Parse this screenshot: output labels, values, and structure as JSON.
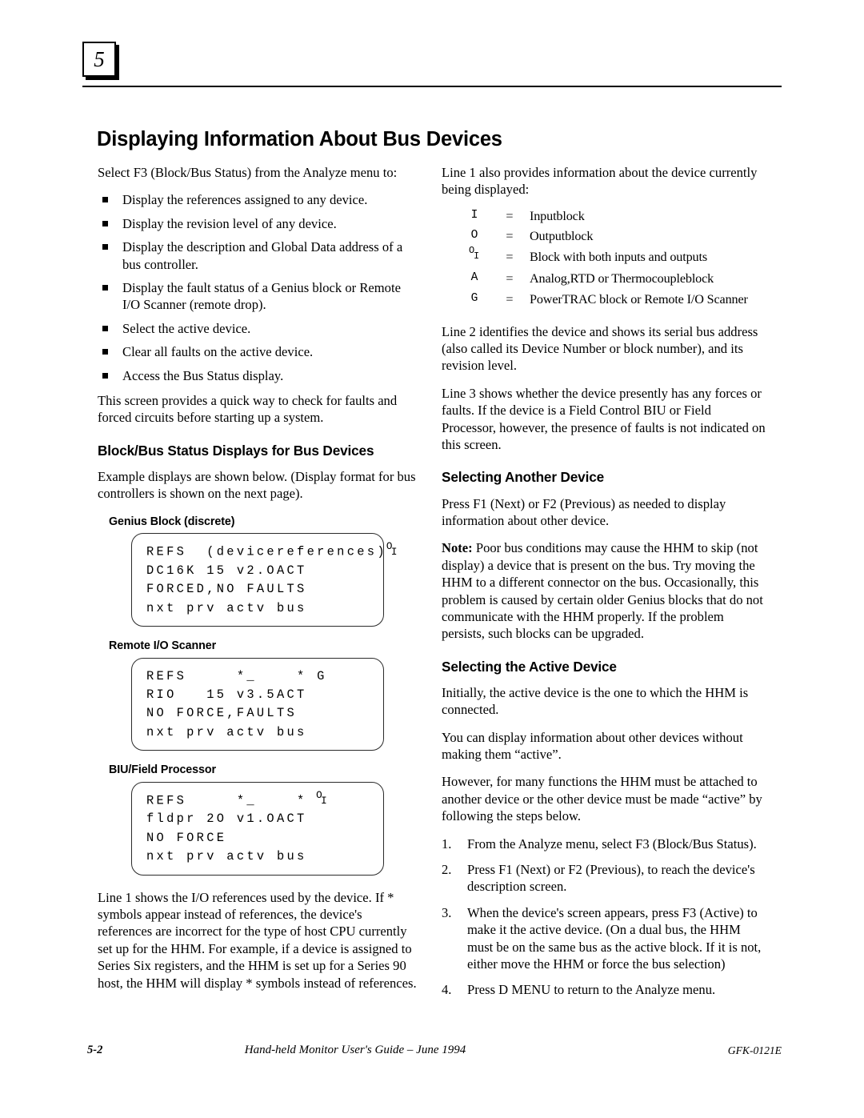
{
  "chapter": {
    "number": "5"
  },
  "page_title": "Displaying Information About Bus Devices",
  "left_column": {
    "intro": "Select F3 (Block/Bus Status) from the Analyze menu to:",
    "bullets": [
      "Display the references assigned to any device.",
      "Display the revision level of any device.",
      "Display the description and Global Data address of a bus controller.",
      "Display the fault status of a Genius block or Remote I/O Scanner (remote drop).",
      "Select the active device.",
      "Clear all faults on the active device.",
      "Access the Bus Status display."
    ],
    "quick_way": "This screen provides a quick way to check for faults and forced circuits before starting up a system.",
    "section_heading": "Block/Bus Status Displays for Bus Devices",
    "example_intro": "Example displays are shown below. (Display format for  bus controllers is shown on the next page).",
    "displays": [
      {
        "label": "Genius Block (discrete)",
        "lines": [
          {
            "pre": "REFS  (devicereferences)",
            "suffix": "oi"
          },
          {
            "pre": "DC16K 15 v2.OACT",
            "suffix": ""
          },
          {
            "pre": "FORCED,NO FAULTS",
            "suffix": ""
          },
          {
            "pre": "nxt prv actv bus",
            "suffix": ""
          }
        ]
      },
      {
        "label": "Remote I/O Scanner",
        "lines": [
          {
            "pre": "REFS     *_    * G",
            "suffix": ""
          },
          {
            "pre": "RIO   15 v3.5ACT",
            "suffix": ""
          },
          {
            "pre": "NO FORCE,FAULTS",
            "suffix": ""
          },
          {
            "pre": "nxt prv actv bus",
            "suffix": ""
          }
        ]
      },
      {
        "label": "BIU/Field Processor",
        "lines": [
          {
            "pre": "REFS     *_    * ",
            "suffix": "oi"
          },
          {
            "pre": "fldpr 2O v1.OACT",
            "suffix": ""
          },
          {
            "pre": "NO FORCE",
            "suffix": ""
          },
          {
            "pre": "nxt prv actv bus",
            "suffix": ""
          }
        ]
      }
    ],
    "line1_para": "Line 1 shows the I/O references used by the device. If * symbols appear instead of references, the device's references are incorrect for the type of host CPU currently set up for the HHM.  For example, if a device is assigned to Series Six registers, and the HHM is set up for a Series 90 host, the HHM will display * symbols instead of references."
  },
  "right_column": {
    "line1_intro": "Line 1 also provides information about the device currently being displayed:",
    "legend": [
      {
        "symbol": "I",
        "symbol_type": "plain",
        "eq": "=",
        "description": "Inputblock"
      },
      {
        "symbol": "O",
        "symbol_type": "plain",
        "eq": "=",
        "description": "Outputblock"
      },
      {
        "symbol": "OI",
        "symbol_type": "oi",
        "eq": "=",
        "description": "Block with both inputs and outputs"
      },
      {
        "symbol": "A",
        "symbol_type": "plain",
        "eq": "=",
        "description": "Analog,RTD or Thermocoupleblock"
      },
      {
        "symbol": "G",
        "symbol_type": "plain",
        "eq": "=",
        "description": "PowerTRAC block or Remote I/O Scanner"
      }
    ],
    "line2_para": "Line 2 identifies the device and shows its serial bus address (also called its Device Number or block number), and its revision level.",
    "line3_para": "Line 3 shows whether the device presently has any forces or faults. If the device is a Field Control BIU or Field Processor, however, the presence of faults is not indicated on this screen.",
    "selecting_another_heading": "Selecting Another Device",
    "selecting_another_para": "Press F1 (Next) or F2 (Previous) as needed to display information about other device.",
    "note_label": "Note:",
    "note_body": " Poor bus conditions may cause the HHM to skip (not display) a device that is present on the bus.  Try moving the HHM to a different connector on the bus. Occasionally, this problem is caused by certain older Genius blocks that do not communicate with the HHM properly. If the problem persists, such blocks can be upgraded.",
    "active_heading": "Selecting the Active Device",
    "active_para1": "Initially, the active device is the one to which the HHM is connected.",
    "active_para2": "You can display information about other devices without making them “active”.",
    "active_para3": "However, for many functions the HHM must be attached to another device or the other device must be made “active” by following the steps below.",
    "steps": [
      {
        "num": "1.",
        "text": "From the Analyze menu, select F3 (Block/Bus Status)."
      },
      {
        "num": "2.",
        "text": "Press F1 (Next) or F2 (Previous), to reach the device's description screen."
      },
      {
        "num": "3.",
        "text": "When the device's screen appears, press F3 (Active) to make it the active device.  (On a dual bus, the HHM must be on the same bus as the active block.  If it is not, either move the HHM or force the bus selection)"
      },
      {
        "num": "4.",
        "text": "Press D MENU to return to the Analyze menu."
      }
    ]
  },
  "footer": {
    "page_number": "5-2",
    "title": "Hand-held Monitor User's Guide – June 1994",
    "doc_id": "GFK-0121E"
  }
}
